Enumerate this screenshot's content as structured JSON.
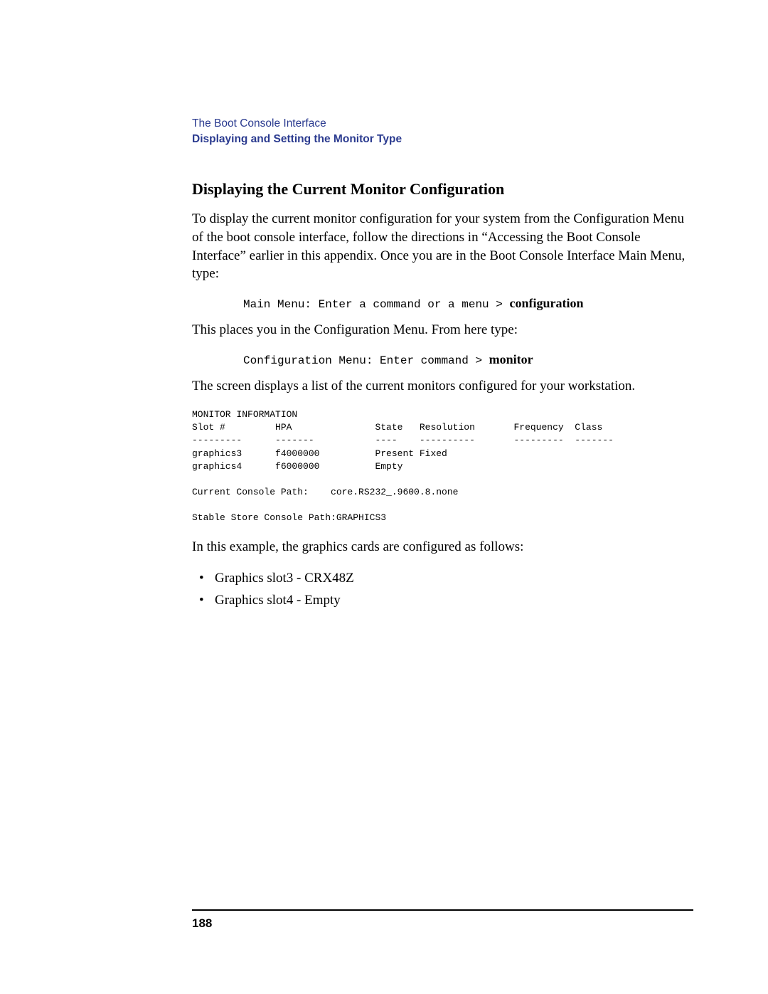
{
  "header": {
    "chapter": "The Boot Console Interface",
    "section": "Displaying and Setting the Monitor Type"
  },
  "content": {
    "heading": "Displaying the Current Monitor Configuration",
    "para1": "To display the current monitor configuration for your system from the Configuration Menu of the boot console interface, follow the directions in “Accessing the Boot Console Interface” earlier in this appendix. Once you are in the Boot Console Interface Main Menu, type:",
    "command1_prefix": "Main Menu: Enter a command or a menu > ",
    "command1_input": "configuration",
    "para2": "This places you in the Configuration Menu. From here type:",
    "command2_prefix": "Configuration Menu: Enter command > ",
    "command2_input": "monitor",
    "para3": "The screen displays a list of the current monitors configured for your workstation.",
    "monitor_output": "MONITOR INFORMATION\nSlot #         HPA               State   Resolution       Frequency  Class\n---------      -------           ----    ----------       ---------  -------\ngraphics3      f4000000          Present Fixed\ngraphics4      f6000000          Empty\n\nCurrent Console Path:    core.RS232_.9600.8.none\n\nStable Store Console Path:GRAPHICS3",
    "para4": "In this example, the graphics cards are configured as follows:",
    "bullets": [
      "Graphics slot3 - CRX48Z",
      "Graphics slot4 - Empty"
    ]
  },
  "footer": {
    "page_number": "188"
  }
}
